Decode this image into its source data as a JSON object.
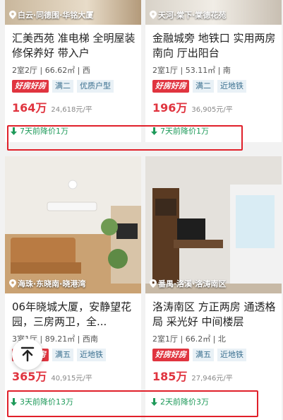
{
  "listings": [
    {
      "location": "白云·同德围·华铭大厦",
      "title": "汇美西苑 准电梯 全明屋装修保养好 带入户",
      "info": "2室2厅 | 66.62㎡ | 西",
      "tags": [
        "好房好房",
        "满二",
        "优质户型"
      ],
      "price": "164万",
      "unit_price": "24,618元/平",
      "drop": "7天前降价1万"
    },
    {
      "location": "天河·棠下·棠德花苑",
      "title": "金融城旁 地铁口 实用两房 南向 厅出阳台",
      "info": "2室1厅 | 53.11㎡ | 南",
      "tags": [
        "好房好房",
        "满二",
        "近地铁"
      ],
      "price": "196万",
      "unit_price": "36,905元/平",
      "drop": "7天前降价1万"
    },
    {
      "location": "海珠·东晓南·晓港湾",
      "title": "06年晓城大厦，安静望花园，三房两卫，全...",
      "info": "3室1厅 | 89.21㎡ | 西南",
      "tags": [
        "好房好房",
        "满五",
        "近地铁"
      ],
      "price": "365万",
      "unit_price": "40,915元/平",
      "drop": "3天前降价13万"
    },
    {
      "location": "番禺·洛溪·洛涛南区",
      "title": "洛涛南区 方正两房 通透格局 采光好 中间楼层",
      "info": "2室1厅 | 66.2㎡ | 北",
      "tags": [
        "好房好房",
        "满五",
        "近地铁"
      ],
      "price": "185万",
      "unit_price": "27,946元/平",
      "drop": "2天前降价3万"
    }
  ],
  "colors": {
    "accent": "#e0343f",
    "drop": "#1e9a5a",
    "highlight_box": "#e0202a"
  }
}
